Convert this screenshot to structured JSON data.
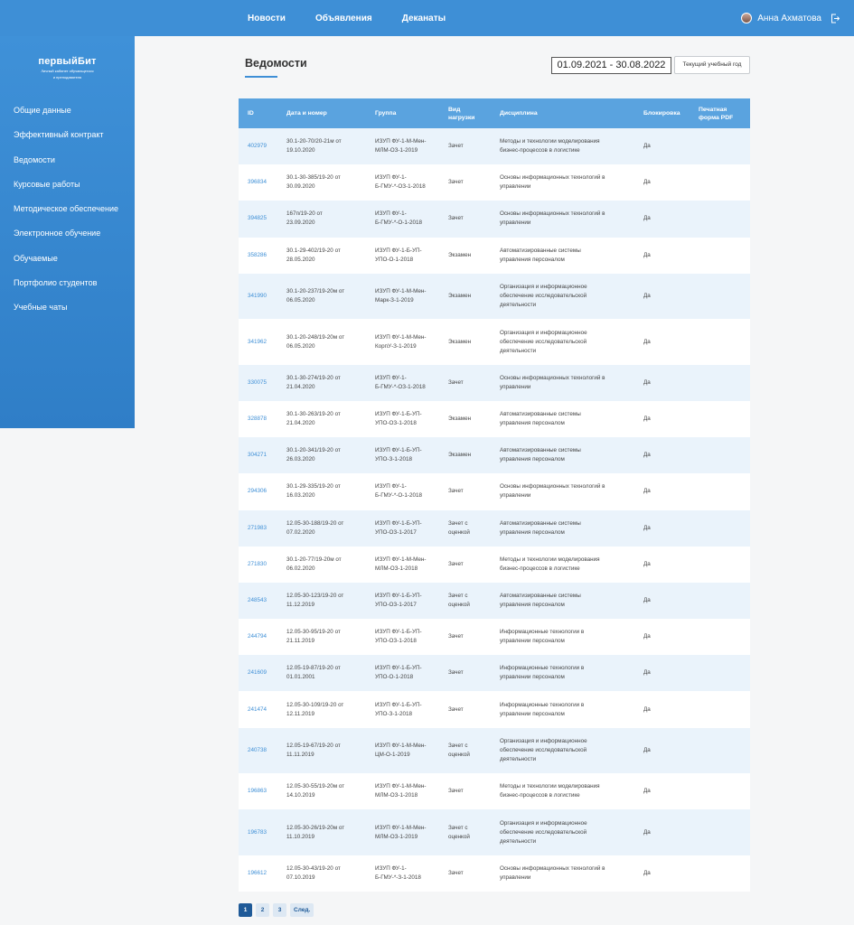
{
  "topnav": [
    "Новости",
    "Объявления",
    "Деканаты"
  ],
  "user": {
    "name": "Анна Ахматова"
  },
  "logo": {
    "main": "первыйБит",
    "sub1": "Личный кабинет обучающегося",
    "sub2": "и преподавателя"
  },
  "sidebar": {
    "items": [
      "Общие данные",
      "Эффективный контракт",
      "Ведомости",
      "Курсовые работы",
      "Методическое обеспечение",
      "Электронное обучение",
      "Обучаемые",
      "Портфолио студентов",
      "Учебные чаты"
    ]
  },
  "page": {
    "title": "Ведомости",
    "period": "01.09.2021 - 30.08.2022",
    "current_year_button": "Текущий учебный год"
  },
  "table": {
    "headers": {
      "id": "ID",
      "date": "Дата и номер",
      "group": "Группа",
      "load1": "Вид",
      "load2": "нагрузки",
      "discipline": "Дисциплина",
      "block": "Блокировка",
      "pdf1": "Печатная",
      "pdf2": "форма PDF"
    },
    "rows": [
      {
        "id": "402979",
        "d1": "30.1-20-70/20-21м от",
        "d2": "19.10.2020",
        "g1": "ИЗУП ФУ-1-М-Мен-",
        "g2": "МЛМ-ОЗ-1-2019",
        "t1": "Зачет",
        "t2": "",
        "s1": "Методы и технологии моделирования",
        "s2": "бизнес-процессов в логистике",
        "s3": "",
        "b": "Да"
      },
      {
        "id": "396834",
        "d1": "30.1-30-385/19-20 от",
        "d2": "30.09.2020",
        "g1": "ИЗУП ФУ-1-",
        "g2": "Б-ГМУ-*-ОЗ-1-2018",
        "t1": "Зачет",
        "t2": "",
        "s1": "Основы информационных технологий в",
        "s2": "управлении",
        "s3": "",
        "b": "Да"
      },
      {
        "id": "394825",
        "d1": "167п/19-20 от",
        "d2": "23.09.2020",
        "g1": "ИЗУП ФУ-1-",
        "g2": "Б-ГМУ-*-О-1-2018",
        "t1": "Зачет",
        "t2": "",
        "s1": "Основы информационных технологий в",
        "s2": "управлении",
        "s3": "",
        "b": "Да"
      },
      {
        "id": "358286",
        "d1": "30.1-29-402/19-20 от",
        "d2": "28.05.2020",
        "g1": "ИЗУП ФУ-1-Б-УП-",
        "g2": "УПО-О-1-2018",
        "t1": "Экзамен",
        "t2": "",
        "s1": "Автоматизированные системы",
        "s2": "управления персоналом",
        "s3": "",
        "b": "Да"
      },
      {
        "id": "341990",
        "d1": "30.1-20-237/19-20м от",
        "d2": "06.05.2020",
        "g1": "ИЗУП ФУ-1-М-Мен-",
        "g2": "Марк-З-1-2019",
        "t1": "Экзамен",
        "t2": "",
        "s1": "Организация и информационное",
        "s2": "обеспечение исследовательской",
        "s3": "деятельности",
        "b": "Да"
      },
      {
        "id": "341962",
        "d1": "30.1-20-248/19-20м от",
        "d2": "06.05.2020",
        "g1": "ИЗУП ФУ-1-М-Мен-",
        "g2": "КорпУ-З-1-2019",
        "t1": "Экзамен",
        "t2": "",
        "s1": "Организация и информационное",
        "s2": "обеспечение исследовательской",
        "s3": "деятельности",
        "b": "Да"
      },
      {
        "id": "330075",
        "d1": "30.1-30-274/19-20 от",
        "d2": "21.04.2020",
        "g1": "ИЗУП ФУ-1-",
        "g2": "Б-ГМУ-*-ОЗ-1-2018",
        "t1": "Зачет",
        "t2": "",
        "s1": "Основы информационных технологий в",
        "s2": "управлении",
        "s3": "",
        "b": "Да"
      },
      {
        "id": "328878",
        "d1": "30.1-30-263/19-20 от",
        "d2": "21.04.2020",
        "g1": "ИЗУП ФУ-1-Б-УП-",
        "g2": "УПО-ОЗ-1-2018",
        "t1": "Экзамен",
        "t2": "",
        "s1": "Автоматизированные системы",
        "s2": "управления персоналом",
        "s3": "",
        "b": "Да"
      },
      {
        "id": "304271",
        "d1": "30.1-20-341/19-20 от",
        "d2": "26.03.2020",
        "g1": "ИЗУП ФУ-1-Б-УП-",
        "g2": "УПО-З-1-2018",
        "t1": "Экзамен",
        "t2": "",
        "s1": "Автоматизированные системы",
        "s2": "управления персоналом",
        "s3": "",
        "b": "Да"
      },
      {
        "id": "294306",
        "d1": "30.1-29-335/19-20 от",
        "d2": "16.03.2020",
        "g1": "ИЗУП ФУ-1-",
        "g2": "Б-ГМУ-*-О-1-2018",
        "t1": "Зачет",
        "t2": "",
        "s1": "Основы информационных технологий в",
        "s2": "управлении",
        "s3": "",
        "b": "Да"
      },
      {
        "id": "271983",
        "d1": "12.05-30-188/19-20 от",
        "d2": "07.02.2020",
        "g1": "ИЗУП ФУ-1-Б-УП-",
        "g2": "УПО-ОЗ-1-2017",
        "t1": "Зачет с",
        "t2": "оценкой",
        "s1": "Автоматизированные системы",
        "s2": "управления персоналом",
        "s3": "",
        "b": "Да"
      },
      {
        "id": "271830",
        "d1": "30.1-20-77/19-20м от",
        "d2": "06.02.2020",
        "g1": "ИЗУП ФУ-1-М-Мен-",
        "g2": "МЛМ-ОЗ-1-2018",
        "t1": "Зачет",
        "t2": "",
        "s1": "Методы и технологии моделирования",
        "s2": "бизнес-процессов в логистике",
        "s3": "",
        "b": "Да"
      },
      {
        "id": "248543",
        "d1": "12.05-30-123/19-20 от",
        "d2": "11.12.2019",
        "g1": "ИЗУП ФУ-1-Б-УП-",
        "g2": "УПО-ОЗ-1-2017",
        "t1": "Зачет с",
        "t2": "оценкой",
        "s1": "Автоматизированные системы",
        "s2": "управления персоналом",
        "s3": "",
        "b": "Да"
      },
      {
        "id": "244794",
        "d1": "12.05-30-95/19-20 от",
        "d2": "21.11.2019",
        "g1": "ИЗУП ФУ-1-Б-УП-",
        "g2": "УПО-ОЗ-1-2018",
        "t1": "Зачет",
        "t2": "",
        "s1": "Информационные технологии в",
        "s2": "управлении персоналом",
        "s3": "",
        "b": "Да"
      },
      {
        "id": "241609",
        "d1": "12.05-19-87/19-20 от",
        "d2": "01.01.2001",
        "g1": "ИЗУП ФУ-1-Б-УП-",
        "g2": "УПО-О-1-2018",
        "t1": "Зачет",
        "t2": "",
        "s1": "Информационные технологии в",
        "s2": "управлении персоналом",
        "s3": "",
        "b": "Да"
      },
      {
        "id": "241474",
        "d1": "12.05-30-109/19-20 от",
        "d2": "12.11.2019",
        "g1": "ИЗУП ФУ-1-Б-УП-",
        "g2": "УПО-З-1-2018",
        "t1": "Зачет",
        "t2": "",
        "s1": "Информационные технологии в",
        "s2": "управлении персоналом",
        "s3": "",
        "b": "Да"
      },
      {
        "id": "240738",
        "d1": "12.05-19-67/19-20 от",
        "d2": "11.11.2019",
        "g1": "ИЗУП ФУ-1-М-Мен-",
        "g2": "ЦМ-О-1-2019",
        "t1": "Зачет с",
        "t2": "оценкой",
        "s1": "Организация и информационное",
        "s2": "обеспечение исследовательской",
        "s3": "деятельности",
        "b": "Да"
      },
      {
        "id": "196863",
        "d1": "12.05-30-55/19-20м от",
        "d2": "14.10.2019",
        "g1": "ИЗУП ФУ-1-М-Мен-",
        "g2": "МЛМ-ОЗ-1-2018",
        "t1": "Зачет",
        "t2": "",
        "s1": "Методы и технологии моделирования",
        "s2": "бизнес-процессов в логистике",
        "s3": "",
        "b": "Да"
      },
      {
        "id": "196783",
        "d1": "12.05-30-26/19-20м от",
        "d2": "11.10.2019",
        "g1": "ИЗУП ФУ-1-М-Мен-",
        "g2": "МЛМ-ОЗ-1-2019",
        "t1": "Зачет с",
        "t2": "оценкой",
        "s1": "Организация и информационное",
        "s2": "обеспечение исследовательской",
        "s3": "деятельности",
        "b": "Да"
      },
      {
        "id": "196612",
        "d1": "12.05-30-43/19-20 от",
        "d2": "07.10.2019",
        "g1": "ИЗУП ФУ-1-",
        "g2": "Б-ГМУ-*-З-1-2018",
        "t1": "Зачет",
        "t2": "",
        "s1": "Основы информационных технологий в",
        "s2": "управлении",
        "s3": "",
        "b": "Да"
      }
    ]
  },
  "pagination": {
    "pages": [
      "1",
      "2",
      "3"
    ],
    "active": "1",
    "next": "След."
  },
  "colors": {
    "accent": "#3e8fd6",
    "header_row": "#5aa3df",
    "row_alt": "#eaf3fb",
    "pager_active": "#1f5a98"
  }
}
